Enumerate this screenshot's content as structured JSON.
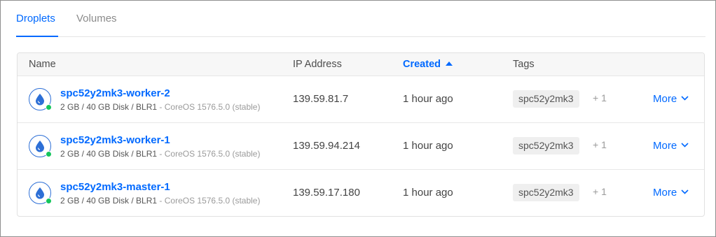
{
  "tabs": [
    {
      "label": "Droplets",
      "active": true
    },
    {
      "label": "Volumes",
      "active": false
    }
  ],
  "table": {
    "columns": {
      "name": "Name",
      "ip": "IP Address",
      "created": "Created",
      "tags": "Tags"
    },
    "rows": [
      {
        "name": "spc52y2mk3-worker-2",
        "specs": "2 GB / 40 GB Disk / BLR1",
        "os": " - CoreOS 1576.5.0 (stable)",
        "ip": "139.59.81.7",
        "created": "1 hour ago",
        "tag": "spc52y2mk3",
        "tag_more": "+ 1",
        "more": "More"
      },
      {
        "name": "spc52y2mk3-worker-1",
        "specs": "2 GB / 40 GB Disk / BLR1",
        "os": " - CoreOS 1576.5.0 (stable)",
        "ip": "139.59.94.214",
        "created": "1 hour ago",
        "tag": "spc52y2mk3",
        "tag_more": "+ 1",
        "more": "More"
      },
      {
        "name": "spc52y2mk3-master-1",
        "specs": "2 GB / 40 GB Disk / BLR1",
        "os": " - CoreOS 1576.5.0 (stable)",
        "ip": "139.59.17.180",
        "created": "1 hour ago",
        "tag": "spc52y2mk3",
        "tag_more": "+ 1",
        "more": "More"
      }
    ]
  },
  "colors": {
    "accent": "#0069ff",
    "status_active": "#14c55b"
  },
  "icons": {
    "droplet": "droplet-icon",
    "sort": "sort-ascending-icon",
    "more": "chevron-down-icon"
  }
}
